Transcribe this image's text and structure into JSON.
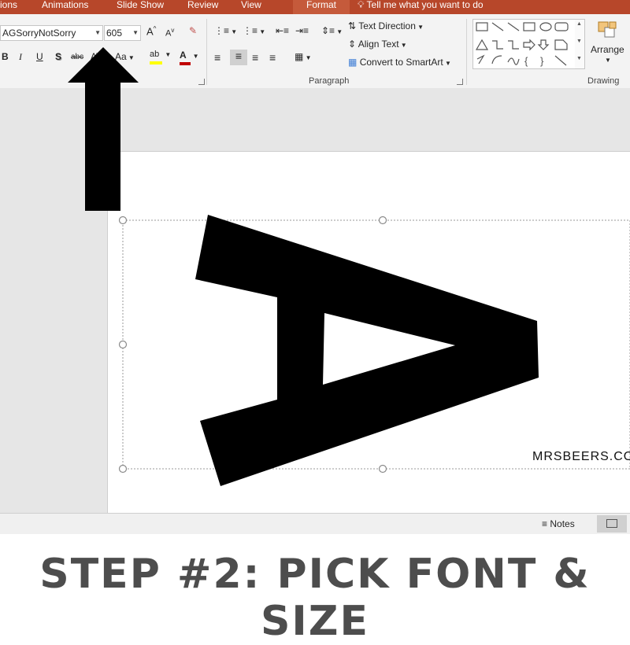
{
  "ribbon": {
    "tabs": [
      {
        "label": "ions"
      },
      {
        "label": "Animations"
      },
      {
        "label": "Slide Show"
      },
      {
        "label": "Review"
      },
      {
        "label": "View"
      },
      {
        "label": "Format",
        "active": true
      }
    ],
    "tell_me": "Tell me what you want to do",
    "font_name": "AGSorryNotSorry",
    "font_size": "605",
    "change_case_label": "Aa",
    "text_direction_label": "Text Direction",
    "align_text_label": "Align Text",
    "convert_smartart_label": "Convert to SmartArt",
    "paragraph_group_label": "Paragraph",
    "arrange_label": "Arrange",
    "drawing_group_label": "Drawing"
  },
  "slide": {
    "letter": "A",
    "watermark": "MRSBEERS.COM"
  },
  "statusbar": {
    "notes_label": "Notes"
  },
  "caption": "STEP #2: PICK FONT & SIZE",
  "colors": {
    "tab_bar": "#b7472a",
    "ribbon": "#f3f3f3",
    "workspace": "#e6e6e6",
    "caption_text": "#4d4d4d",
    "highlight_yellow": "#ffff00",
    "font_color_red": "#c00000"
  }
}
